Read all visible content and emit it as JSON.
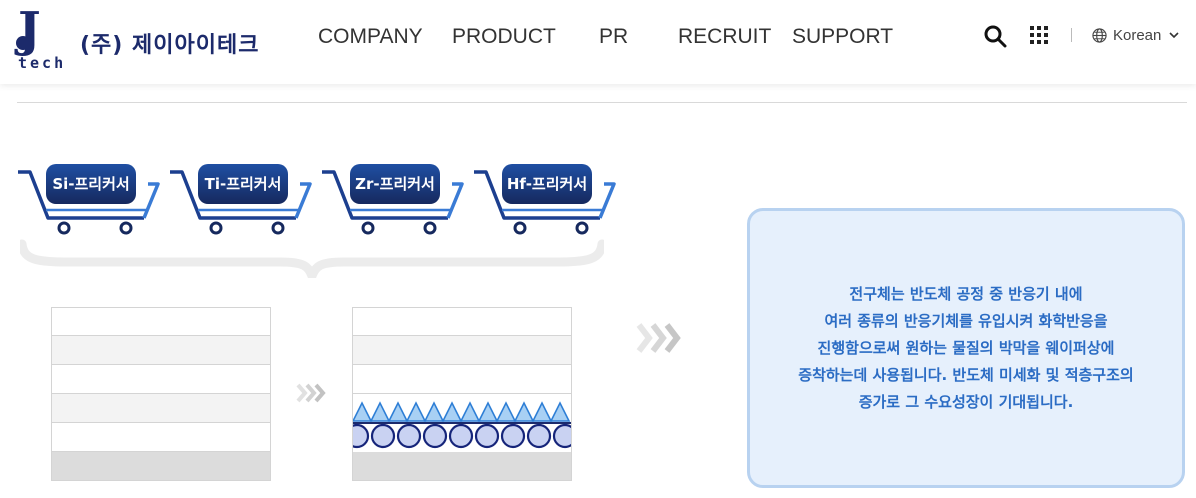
{
  "header": {
    "logo_mark": "J",
    "logo_sub": "tech",
    "company_name": "(주) 제이아이테크",
    "nav": [
      "COMPANY",
      "PRODUCT",
      "PR",
      "RECRUIT",
      "SUPPORT"
    ],
    "language": "Korean",
    "icons": {
      "search": "search-icon",
      "menu": "grid-menu-icon",
      "language": "globe-icon",
      "dropdown": "chevron-down-icon"
    }
  },
  "carts": [
    {
      "label": "Si-프리커서"
    },
    {
      "label": "Ti-프리커서"
    },
    {
      "label": "Zr-프리커서"
    },
    {
      "label": "Hf-프리커서"
    }
  ],
  "stacks": {
    "before_caption": "",
    "after_caption": ""
  },
  "info": {
    "lines": [
      "전구체는 반도체 공정 중 반응기 내에",
      "여러 종류의 반응기체를 유입시켜 화학반응을",
      "진행함으로써 원하는 물질의 박막을 웨이퍼상에",
      "증착하는데 사용됩니다. 반도체 미세화 및 적층구조의",
      "증가로 그 수요성장이 기대됩니다."
    ]
  },
  "colors": {
    "brand_navy": "#1c2a6b",
    "cart_blue": "#1f4fa3",
    "info_text": "#2b6cc4",
    "info_bg": "#e6f0fc",
    "triangle": "#8fc0ef",
    "circle": "#c9d4f2"
  }
}
